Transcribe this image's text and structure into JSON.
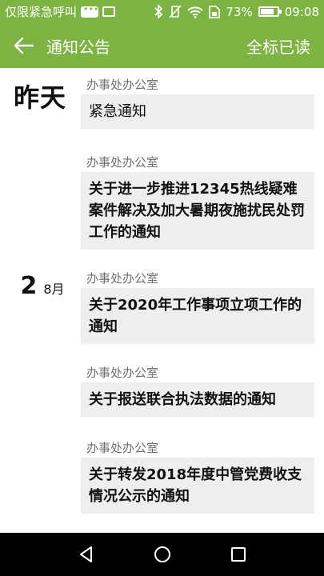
{
  "status_bar": {
    "carrier": "仅限紧急呼叫",
    "battery_percent": "73%",
    "battery_level": 0.73,
    "time": "09:08",
    "icons": [
      "message-icon",
      "image-icon",
      "bluetooth-icon",
      "vibrate-icon",
      "wifi-icon",
      "sim-icon",
      "battery-icon"
    ]
  },
  "app_bar": {
    "title": "通知公告",
    "action": "全标已读"
  },
  "groups": [
    {
      "label": "昨天"
    },
    {
      "day": "2",
      "month": "8月"
    }
  ],
  "notices": [
    {
      "source": "办事处办公室",
      "title": "紧急通知",
      "unread": false
    },
    {
      "source": "办事处办公室",
      "title": "关于进一步推进12345热线疑难案件解决及加大暑期夜施扰民处罚工作的通知",
      "unread": true
    },
    {
      "source": "办事处办公室",
      "title": "关于2020年工作事项立项工作的通知",
      "unread": true
    },
    {
      "source": "办事处办公室",
      "title": "关于报送联合执法数据的通知",
      "unread": true
    },
    {
      "source": "办事处办公室",
      "title": "关于转发2018年度中管党费收支情况公示的通知",
      "unread": true
    }
  ],
  "colors": {
    "primary": "#7cb342",
    "card_bg": "#eeeeef",
    "nav_bg": "#000000"
  }
}
